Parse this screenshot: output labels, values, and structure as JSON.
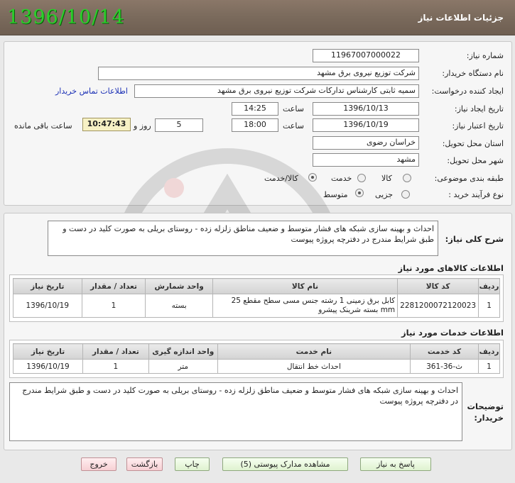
{
  "header": {
    "title": "جزئیات اطلاعات نیاز",
    "date": "1396/10/14"
  },
  "form": {
    "need_number_label": "شماره نیاز:",
    "need_number": "11967007000022",
    "buyer_label": "نام دستگاه خریدار:",
    "buyer": "شرکت توزیع نیروی برق مشهد",
    "creator_label": "ایجاد کننده درخواست:",
    "creator": "سمیه ثابتی کارشناس تدارکات شرکت توزیع نیروی برق مشهد",
    "contact_link": "اطلاعات تماس خریدار",
    "created_date_label": "تاریخ ایجاد نیاز:",
    "created_date": "1396/10/13",
    "time_label": "ساعت",
    "created_time": "14:25",
    "validity_label": "تاریخ اعتبار نیاز:",
    "validity_date": "1396/10/19",
    "validity_time": "18:00",
    "days": "5",
    "days_label": "روز و",
    "remaining": "10:47:43",
    "remaining_label": "ساعت باقی مانده",
    "province_label": "استان محل تحویل:",
    "province": "خراسان رضوی",
    "city_label": "شهر محل تحویل:",
    "city": "مشهد",
    "category_label": "طبقه بندی موضوعی:",
    "category_options": [
      "کالا",
      "خدمت",
      "کالا/خدمت"
    ],
    "process_label": "نوع فرآیند خرید :",
    "process_options": [
      "جزیی",
      "متوسط"
    ]
  },
  "description": {
    "label": "شرح کلی نیاز:",
    "text": "احداث و  بهینه سازی شبکه های فشار متوسط و ضعیف مناطق  زلزله زده - روستای بریلی به صورت کلید در دست و طبق شرایط مندرج در دفترچه پروژه پیوست"
  },
  "goods": {
    "title": "اطلاعات کالاهای مورد نیاز",
    "headers": [
      "ردیف",
      "کد کالا",
      "نام کالا",
      "واحد شمارش",
      "تعداد / مقدار",
      "تاریخ نیاز"
    ],
    "rows": [
      [
        "1",
        "2281200072120023",
        "کابل برق زمینی 1 رشته جنس مسی سطح مقطع 25 mm بسته شرینک پیشرو",
        "بسته",
        "1",
        "1396/10/19"
      ]
    ]
  },
  "services": {
    "title": "اطلاعات خدمات مورد نیاز",
    "headers": [
      "ردیف",
      "کد خدمت",
      "نام خدمت",
      "واحد اندازه گیری",
      "تعداد / مقدار",
      "تاریخ نیاز"
    ],
    "rows": [
      [
        "1",
        "ث-36-361",
        "احداث خط انتقال",
        "متر",
        "1",
        "1396/10/19"
      ]
    ]
  },
  "buyer_notes": {
    "label": "توضیحات خریدار:",
    "text": "احداث و  بهینه سازی شبکه های فشار متوسط و ضعیف مناطق  زلزله زده - روستای بریلی به صورت کلید در دست و طبق شرایط مندرج در دفترچه پروژه پیوست"
  },
  "buttons": {
    "reply": "پاسخ به نیاز",
    "attachments": "مشاهده مدارک پیوستی (5)",
    "print": "چاپ",
    "back": "بازگشت",
    "exit": "خروج"
  }
}
